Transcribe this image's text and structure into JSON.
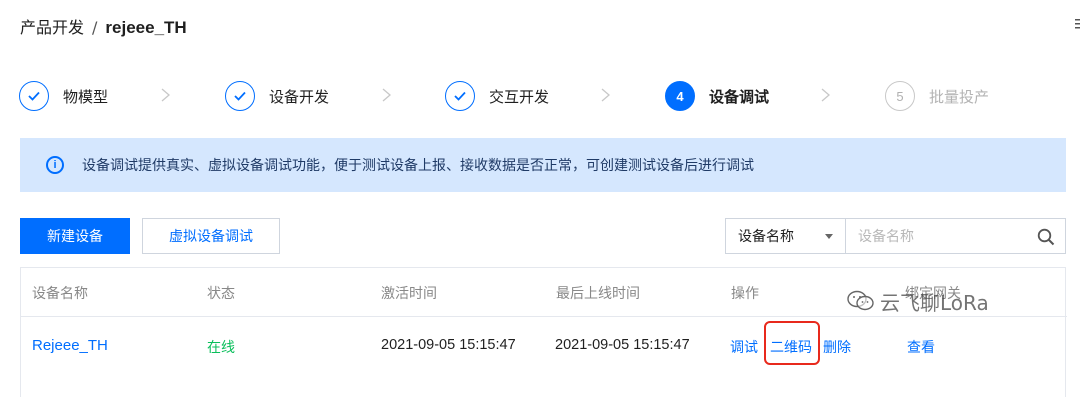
{
  "breadcrumb": {
    "parent": "产品开发",
    "separator": "/",
    "current": "rejeee_TH"
  },
  "steps": [
    {
      "label": "物模型",
      "state": "done"
    },
    {
      "label": "设备开发",
      "state": "done"
    },
    {
      "label": "交互开发",
      "state": "done"
    },
    {
      "label": "设备调试",
      "number": "4",
      "state": "active"
    },
    {
      "label": "批量投产",
      "number": "5",
      "state": "todo"
    }
  ],
  "notice": {
    "text": "设备调试提供真实、虚拟设备调试功能，便于测试设备上报、接收数据是否正常，可创建测试设备后进行调试",
    "icon": "info-icon"
  },
  "toolbar": {
    "new_device_label": "新建设备",
    "virtual_debug_label": "虚拟设备调试",
    "filter_selected": "设备名称",
    "search_placeholder": "设备名称"
  },
  "table": {
    "columns": [
      "设备名称",
      "状态",
      "激活时间",
      "最后上线时间",
      "操作",
      "绑定网关"
    ],
    "rows": [
      {
        "device_name": "Rejeee_TH",
        "status": "在线",
        "activated_at": "2021-09-05 15:15:47",
        "last_online": "2021-09-05 15:15:47",
        "ops": {
          "debug": "调试",
          "qrcode": "二维码",
          "delete": "删除"
        },
        "gateway": "查看"
      }
    ]
  },
  "watermark": {
    "text": "云飞聊LoRa"
  },
  "colors": {
    "accent": "#006eff",
    "online": "#0abf5b",
    "highlight": "#e8291c",
    "notice_bg": "#d5e7fe"
  }
}
